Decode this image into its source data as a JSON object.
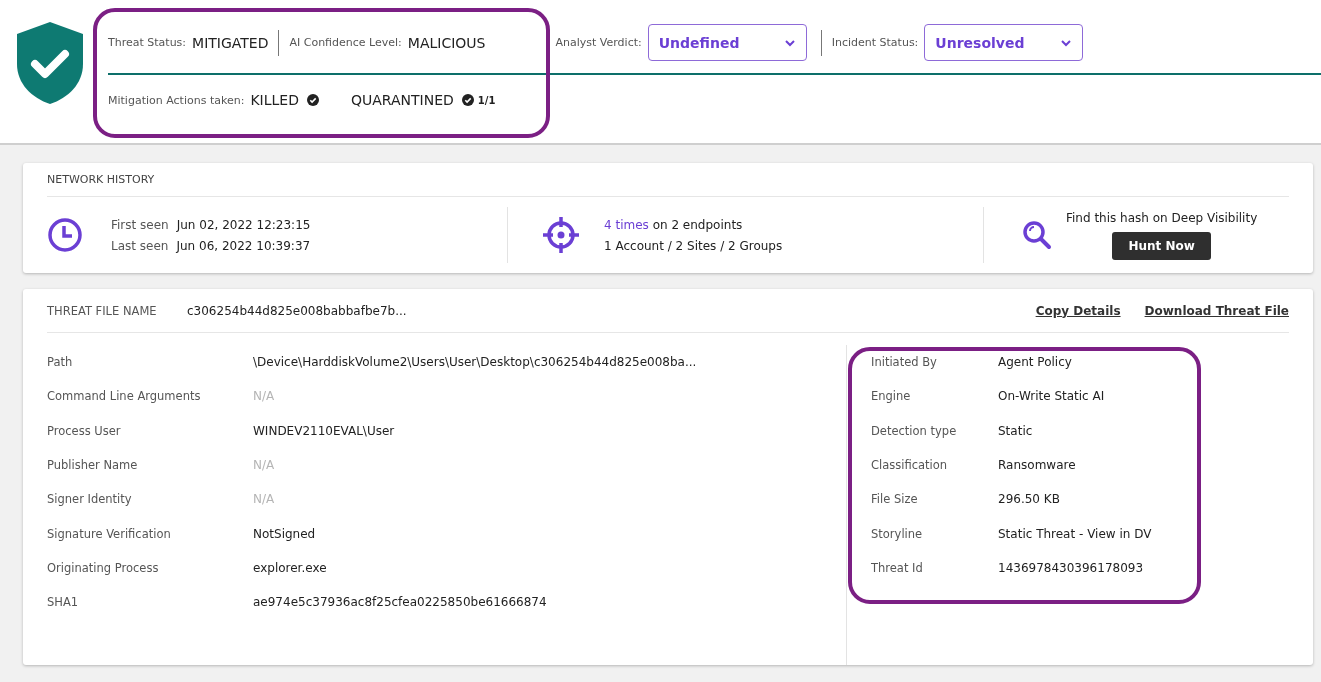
{
  "header": {
    "status_items": [
      {
        "label": "Threat Status:",
        "value": "MITIGATED"
      },
      {
        "label": "AI Confidence Level:",
        "value": "MALICIOUS"
      }
    ],
    "dropdowns": [
      {
        "label": "Analyst Verdict:",
        "value": "Undefined"
      },
      {
        "label": "Incident Status:",
        "value": "Unresolved"
      }
    ],
    "mitigation": {
      "label": "Mitigation Actions taken:",
      "actions": [
        {
          "name": "KILLED",
          "done": true
        },
        {
          "name": "QUARANTINED",
          "done": true,
          "count": "1/1"
        }
      ]
    }
  },
  "network_history": {
    "title": "NETWORK HISTORY",
    "seen": [
      {
        "label": "First seen",
        "value": "Jun 02, 2022 12:23:15"
      },
      {
        "label": "Last seen",
        "value": "Jun 06, 2022 10:39:37"
      }
    ],
    "times_link": "4 times",
    "times_rest": "on",
    "endpoints": "2 endpoints",
    "scope": "1 Account / 2 Sites / 2 Groups",
    "hunt_text": "Find this hash on Deep Visibility",
    "hunt_button": "Hunt Now"
  },
  "threat_file": {
    "label": "THREAT FILE NAME",
    "name": "c306254b44d825e008babbafbe7b...",
    "actions": [
      "Copy Details",
      "Download Threat File"
    ],
    "left_rows": [
      {
        "label": "Path",
        "value": "\\Device\\HarddiskVolume2\\Users\\User\\Desktop\\c306254b44d825e008ba...",
        "dim": false
      },
      {
        "label": "Command Line Arguments",
        "value": "N/A",
        "dim": true
      },
      {
        "label": "Process User",
        "value": "WINDEV2110EVAL\\User",
        "dim": false
      },
      {
        "label": "Publisher Name",
        "value": "N/A",
        "dim": true
      },
      {
        "label": "Signer Identity",
        "value": "N/A",
        "dim": true
      },
      {
        "label": "Signature Verification",
        "value": "NotSigned",
        "dim": false
      },
      {
        "label": "Originating Process",
        "value": "explorer.exe",
        "dim": false
      },
      {
        "label": "SHA1",
        "value": "ae974e5c37936ac8f25cfea0225850be61666874",
        "dim": false
      }
    ],
    "right_rows": [
      {
        "label": "Initiated By",
        "value": "Agent Policy"
      },
      {
        "label": "Engine",
        "value": "On-Write Static AI"
      },
      {
        "label": "Detection type",
        "value": "Static"
      },
      {
        "label": "Classification",
        "value": "Ransomware"
      },
      {
        "label": "File Size",
        "value": "296.50 KB"
      },
      {
        "label": "Storyline",
        "value": "Static Threat - View in DV"
      },
      {
        "label": "Threat Id",
        "value": "1436978430396178093"
      }
    ]
  }
}
